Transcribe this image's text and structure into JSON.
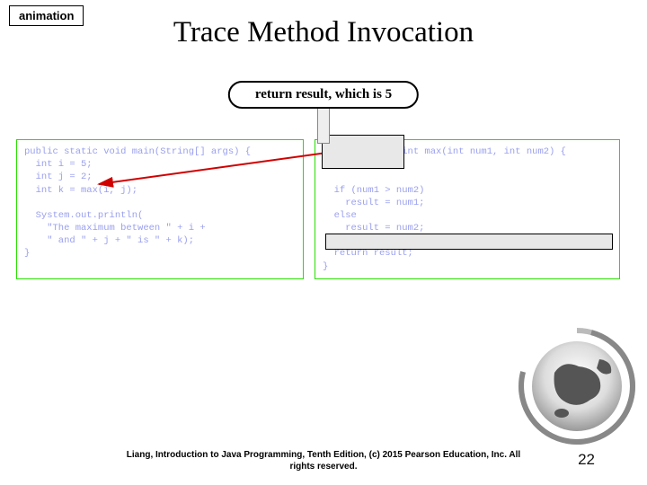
{
  "badge": "animation",
  "title": "Trace Method Invocation",
  "callout": "return result, which is 5",
  "code_left": "public static void main(String[] args) {\n  int i = 5;\n  int j = 2;\n  int k = max(i, j);\n\n  System.out.println(\n    \"The maximum between \" + i +\n    \" and \" + j + \" is \" + k);\n}",
  "code_right": "public static int max(int num1, int num2) {\n  int result;\n\n  if (num1 > num2)\n    result = num1;\n  else\n    result = num2;\n\n  return result;\n}",
  "footer_line1": "Liang, Introduction to Java Programming, Tenth Edition, (c) 2015 Pearson Education, Inc. All",
  "footer_line2": "rights reserved.",
  "page_number": "22"
}
